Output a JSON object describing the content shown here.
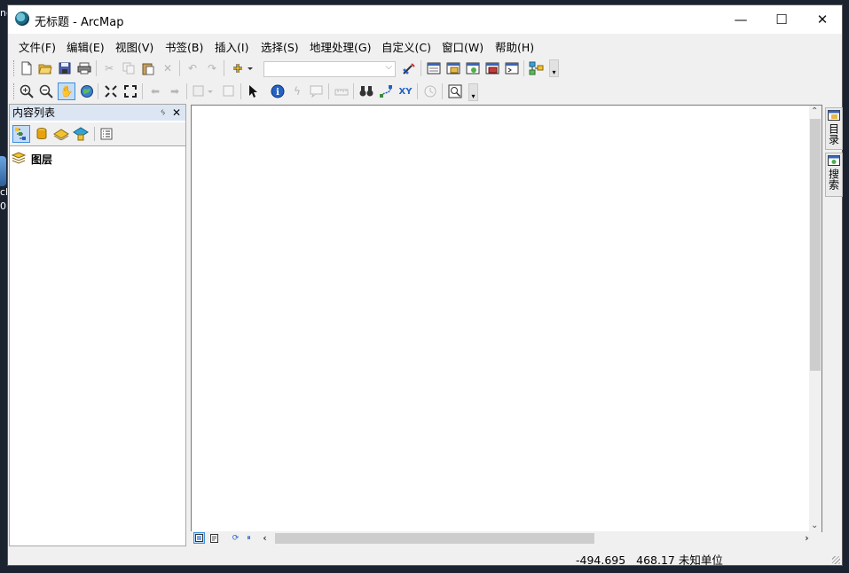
{
  "window": {
    "title": "无标题 - ArcMap"
  },
  "desktop_fragments": [
    "nc",
    "cM",
    "0"
  ],
  "window_controls": {
    "minimize": "—",
    "maximize": "☐",
    "close": "✕"
  },
  "menu": [
    {
      "label": "文件(F)"
    },
    {
      "label": "编辑(E)"
    },
    {
      "label": "视图(V)"
    },
    {
      "label": "书签(B)"
    },
    {
      "label": "插入(I)"
    },
    {
      "label": "选择(S)"
    },
    {
      "label": "地理处理(G)"
    },
    {
      "label": "自定义(C)"
    },
    {
      "label": "窗口(W)"
    },
    {
      "label": "帮助(H)"
    }
  ],
  "toolbar1": {
    "icons": [
      "new-document-icon",
      "open-folder-icon",
      "save-icon",
      "print-icon",
      "cut-icon",
      "copy-icon",
      "paste-icon",
      "delete-icon",
      "undo-icon",
      "redo-icon",
      "add-data-icon",
      "scale-combo",
      "editor-icon",
      "table-window-icon",
      "catalog-window-icon",
      "search-window-icon",
      "arctoolbox-icon",
      "python-window-icon",
      "modelbuilder-icon"
    ],
    "scale_value": ""
  },
  "toolbar2": {
    "icons": [
      "zoom-in-icon",
      "zoom-out-icon",
      "pan-icon",
      "full-extent-icon",
      "fixed-zoom-in-icon",
      "fixed-zoom-out-icon",
      "back-icon",
      "forward-icon",
      "select-features-icon",
      "clear-selection-icon",
      "select-elements-icon",
      "identify-icon",
      "hyperlink-icon",
      "html-popup-icon",
      "measure-icon",
      "find-icon",
      "find-route-icon",
      "go-to-xy-icon",
      "time-slider-icon",
      "magnifier-window-icon"
    ],
    "go_to_xy_label": "XY"
  },
  "toc": {
    "title": "内容列表",
    "pin": "ᛃ",
    "close": "✕",
    "root_layer": "图层"
  },
  "dock_tabs": [
    {
      "label": "目录"
    },
    {
      "label": "搜索"
    }
  ],
  "status": {
    "x": "-494.695",
    "y": "468.17",
    "unit": "未知单位"
  },
  "colors": {
    "titlebar": "#ffffff",
    "chrome": "#f0f0f0",
    "toc_header": "#dce6f3",
    "active_tool": "#c5dcf5",
    "accent": "#3d8ee0"
  }
}
